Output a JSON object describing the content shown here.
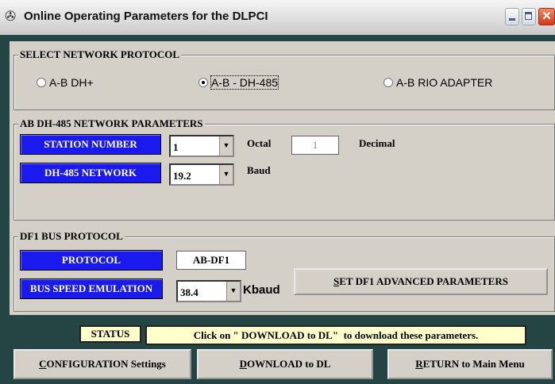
{
  "window": {
    "title": "Online Operating Parameters for the DLPCI"
  },
  "protocol": {
    "legend": "SELECT NETWORK PROTOCOL",
    "options": [
      "A-B DH+",
      "A-B - DH-485",
      "A-B RIO ADAPTER"
    ],
    "selected_index": 1
  },
  "dh485": {
    "legend": "AB DH-485 NETWORK PARAMETERS",
    "station_label": "STATION NUMBER",
    "station_value": "1",
    "octal_label": "Octal",
    "decimal_value": "1",
    "decimal_label": "Decimal",
    "network_label": "DH-485 NETWORK",
    "network_value": "19.2",
    "baud_label": "Baud"
  },
  "df1": {
    "legend": "DF1 BUS PROTOCOL",
    "protocol_label": "PROTOCOL",
    "protocol_value": "AB-DF1",
    "speed_label": "BUS SPEED EMULATION",
    "speed_value": "38.4",
    "kbaud_label": "Kbaud",
    "advanced_button_hotkey": "S",
    "advanced_button_rest": "ET DF1 ADVANCED PARAMETERS"
  },
  "status": {
    "label": "STATUS",
    "message": "Click on \" DOWNLOAD to DL\"  to download these parameters."
  },
  "footer": {
    "config_hotkey": "C",
    "config_rest": "ONFIGURATION Settings",
    "download_hotkey": "D",
    "download_rest": "OWNLOAD to DL",
    "return_hotkey": "R",
    "return_rest": "ETURN to Main Menu"
  },
  "colors": {
    "label_blue": "#1a1aee",
    "status_yellow": "#ffffcc",
    "frame_teal": "#254545"
  }
}
